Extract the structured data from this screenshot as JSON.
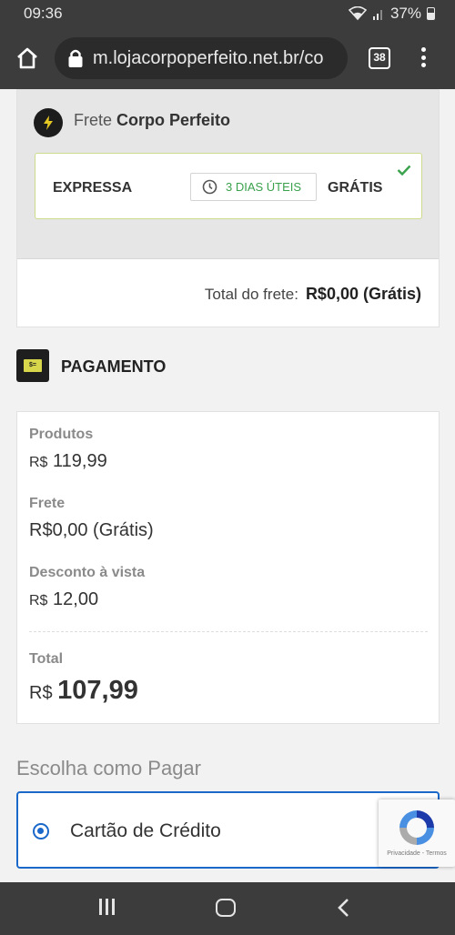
{
  "status_bar": {
    "time": "09:36",
    "battery": "37%"
  },
  "browser": {
    "url": "m.lojacorpoperfeito.net.br/co",
    "tab_count": "38"
  },
  "shipping": {
    "label_prefix": "Frete",
    "label_bold": "Corpo Perfeito",
    "option": {
      "name": "EXPRESSA",
      "days": "3 DIAS ÚTEIS",
      "price": "GRÁTIS"
    },
    "total_label": "Total do frete:",
    "total_value": "R$0,00 (Grátis)"
  },
  "payment": {
    "icon_text": "$=",
    "title": "PAGAMENTO",
    "products_label": "Produtos",
    "products_currency": "R$",
    "products_value": "119,99",
    "freight_label": "Frete",
    "freight_value": "R$0,00 (Grátis)",
    "discount_label": "Desconto à vista",
    "discount_currency": "R$",
    "discount_value": "12,00",
    "total_label": "Total",
    "total_currency": "R$",
    "total_value": "107,99"
  },
  "choose": {
    "title": "Escolha como Pagar",
    "method_label": "Cartão de Crédito"
  },
  "recaptcha": {
    "text": "Privacidade - Termos"
  },
  "colors": {
    "accent": "#1a68c9",
    "success": "#3aa14c",
    "option_border": "#cddc8a"
  }
}
